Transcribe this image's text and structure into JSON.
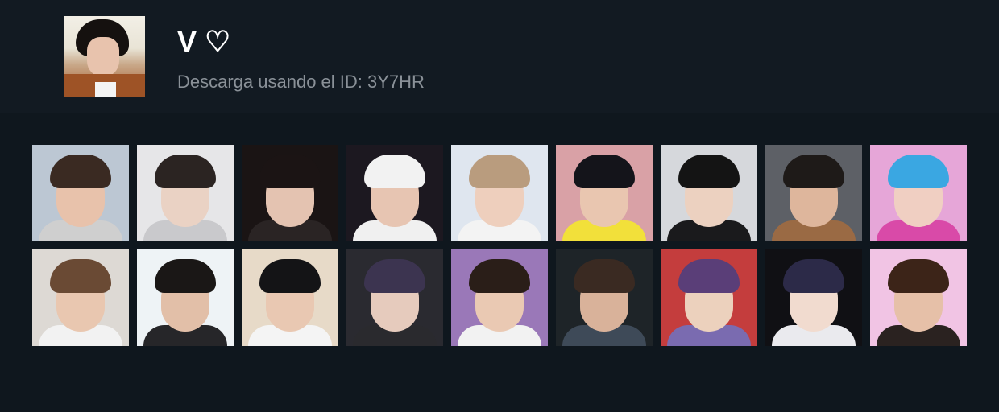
{
  "header": {
    "title": "V ♡",
    "subtitle": "Descarga usando el ID: 3Y7HR"
  },
  "stickers": [
    {
      "bg": "#bcc7d3",
      "hair": "#3a2a22",
      "skin": "#e8c2ab",
      "body": "#cfcfcf"
    },
    {
      "bg": "#e6e6e8",
      "hair": "#2b2422",
      "skin": "#ead2c4",
      "body": "#c9c9cc"
    },
    {
      "bg": "#1a1414",
      "hair": "#1b1414",
      "skin": "#e4c3b1",
      "body": "#2a2424"
    },
    {
      "bg": "#1c1820",
      "hair": "#f2f2f2",
      "skin": "#e7c5b2",
      "body": "#f0f0f0"
    },
    {
      "bg": "#dfe6ef",
      "hair": "#b99c7e",
      "skin": "#eecfbd",
      "body": "#f3f3f3"
    },
    {
      "bg": "#d9a1a6",
      "hair": "#14141a",
      "skin": "#e9c6b0",
      "body": "#f2e03a"
    },
    {
      "bg": "#d6d8dc",
      "hair": "#141414",
      "skin": "#ecd1c0",
      "body": "#1a1a1c"
    },
    {
      "bg": "#5d6066",
      "hair": "#1e1a18",
      "skin": "#deb69c",
      "body": "#9a6a44"
    },
    {
      "bg": "#e6a6d8",
      "hair": "#3aa7e2",
      "skin": "#f0cfc2",
      "body": "#d94aa8"
    },
    {
      "bg": "#ddd9d4",
      "hair": "#6a4a34",
      "skin": "#e9c7b0",
      "body": "#f2f2f2"
    },
    {
      "bg": "#eef3f6",
      "hair": "#1a1716",
      "skin": "#e2bfa8",
      "body": "#262629"
    },
    {
      "bg": "#e7dac8",
      "hair": "#141416",
      "skin": "#e9c8b2",
      "body": "#f4f4f4"
    },
    {
      "bg": "#2a2a30",
      "hair": "#3c3450",
      "skin": "#e6cbbd",
      "body": "#2a2a2e"
    },
    {
      "bg": "#9a78b8",
      "hair": "#2a1e18",
      "skin": "#eac9b3",
      "body": "#f2f2f2"
    },
    {
      "bg": "#1e2428",
      "hair": "#3a2a22",
      "skin": "#d9b29a",
      "body": "#3e4a58"
    },
    {
      "bg": "#c43d3d",
      "hair": "#5a3e78",
      "skin": "#ecd1bd",
      "body": "#7a6bb0"
    },
    {
      "bg": "#101014",
      "hair": "#2c2a48",
      "skin": "#f1dbcf",
      "body": "#eaeaee"
    },
    {
      "bg": "#f1c4e4",
      "hair": "#3c2418",
      "skin": "#e6c0a8",
      "body": "#2a2220"
    }
  ]
}
